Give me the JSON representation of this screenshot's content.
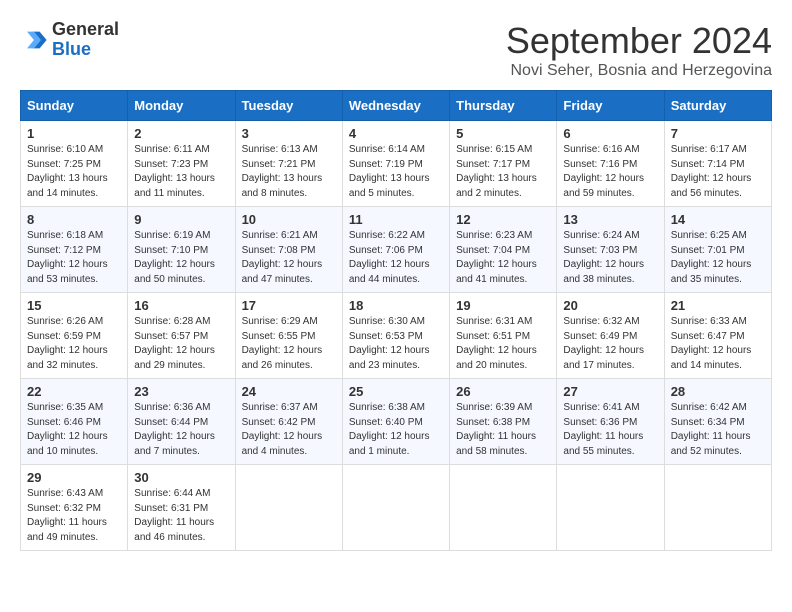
{
  "logo": {
    "general": "General",
    "blue": "Blue"
  },
  "title": "September 2024",
  "location": "Novi Seher, Bosnia and Herzegovina",
  "days_of_week": [
    "Sunday",
    "Monday",
    "Tuesday",
    "Wednesday",
    "Thursday",
    "Friday",
    "Saturday"
  ],
  "weeks": [
    [
      {
        "day": "1",
        "info": "Sunrise: 6:10 AM\nSunset: 7:25 PM\nDaylight: 13 hours\nand 14 minutes."
      },
      {
        "day": "2",
        "info": "Sunrise: 6:11 AM\nSunset: 7:23 PM\nDaylight: 13 hours\nand 11 minutes."
      },
      {
        "day": "3",
        "info": "Sunrise: 6:13 AM\nSunset: 7:21 PM\nDaylight: 13 hours\nand 8 minutes."
      },
      {
        "day": "4",
        "info": "Sunrise: 6:14 AM\nSunset: 7:19 PM\nDaylight: 13 hours\nand 5 minutes."
      },
      {
        "day": "5",
        "info": "Sunrise: 6:15 AM\nSunset: 7:17 PM\nDaylight: 13 hours\nand 2 minutes."
      },
      {
        "day": "6",
        "info": "Sunrise: 6:16 AM\nSunset: 7:16 PM\nDaylight: 12 hours\nand 59 minutes."
      },
      {
        "day": "7",
        "info": "Sunrise: 6:17 AM\nSunset: 7:14 PM\nDaylight: 12 hours\nand 56 minutes."
      }
    ],
    [
      {
        "day": "8",
        "info": "Sunrise: 6:18 AM\nSunset: 7:12 PM\nDaylight: 12 hours\nand 53 minutes."
      },
      {
        "day": "9",
        "info": "Sunrise: 6:19 AM\nSunset: 7:10 PM\nDaylight: 12 hours\nand 50 minutes."
      },
      {
        "day": "10",
        "info": "Sunrise: 6:21 AM\nSunset: 7:08 PM\nDaylight: 12 hours\nand 47 minutes."
      },
      {
        "day": "11",
        "info": "Sunrise: 6:22 AM\nSunset: 7:06 PM\nDaylight: 12 hours\nand 44 minutes."
      },
      {
        "day": "12",
        "info": "Sunrise: 6:23 AM\nSunset: 7:04 PM\nDaylight: 12 hours\nand 41 minutes."
      },
      {
        "day": "13",
        "info": "Sunrise: 6:24 AM\nSunset: 7:03 PM\nDaylight: 12 hours\nand 38 minutes."
      },
      {
        "day": "14",
        "info": "Sunrise: 6:25 AM\nSunset: 7:01 PM\nDaylight: 12 hours\nand 35 minutes."
      }
    ],
    [
      {
        "day": "15",
        "info": "Sunrise: 6:26 AM\nSunset: 6:59 PM\nDaylight: 12 hours\nand 32 minutes."
      },
      {
        "day": "16",
        "info": "Sunrise: 6:28 AM\nSunset: 6:57 PM\nDaylight: 12 hours\nand 29 minutes."
      },
      {
        "day": "17",
        "info": "Sunrise: 6:29 AM\nSunset: 6:55 PM\nDaylight: 12 hours\nand 26 minutes."
      },
      {
        "day": "18",
        "info": "Sunrise: 6:30 AM\nSunset: 6:53 PM\nDaylight: 12 hours\nand 23 minutes."
      },
      {
        "day": "19",
        "info": "Sunrise: 6:31 AM\nSunset: 6:51 PM\nDaylight: 12 hours\nand 20 minutes."
      },
      {
        "day": "20",
        "info": "Sunrise: 6:32 AM\nSunset: 6:49 PM\nDaylight: 12 hours\nand 17 minutes."
      },
      {
        "day": "21",
        "info": "Sunrise: 6:33 AM\nSunset: 6:47 PM\nDaylight: 12 hours\nand 14 minutes."
      }
    ],
    [
      {
        "day": "22",
        "info": "Sunrise: 6:35 AM\nSunset: 6:46 PM\nDaylight: 12 hours\nand 10 minutes."
      },
      {
        "day": "23",
        "info": "Sunrise: 6:36 AM\nSunset: 6:44 PM\nDaylight: 12 hours\nand 7 minutes."
      },
      {
        "day": "24",
        "info": "Sunrise: 6:37 AM\nSunset: 6:42 PM\nDaylight: 12 hours\nand 4 minutes."
      },
      {
        "day": "25",
        "info": "Sunrise: 6:38 AM\nSunset: 6:40 PM\nDaylight: 12 hours\nand 1 minute."
      },
      {
        "day": "26",
        "info": "Sunrise: 6:39 AM\nSunset: 6:38 PM\nDaylight: 11 hours\nand 58 minutes."
      },
      {
        "day": "27",
        "info": "Sunrise: 6:41 AM\nSunset: 6:36 PM\nDaylight: 11 hours\nand 55 minutes."
      },
      {
        "day": "28",
        "info": "Sunrise: 6:42 AM\nSunset: 6:34 PM\nDaylight: 11 hours\nand 52 minutes."
      }
    ],
    [
      {
        "day": "29",
        "info": "Sunrise: 6:43 AM\nSunset: 6:32 PM\nDaylight: 11 hours\nand 49 minutes."
      },
      {
        "day": "30",
        "info": "Sunrise: 6:44 AM\nSunset: 6:31 PM\nDaylight: 11 hours\nand 46 minutes."
      },
      {
        "day": "",
        "info": ""
      },
      {
        "day": "",
        "info": ""
      },
      {
        "day": "",
        "info": ""
      },
      {
        "day": "",
        "info": ""
      },
      {
        "day": "",
        "info": ""
      }
    ]
  ]
}
